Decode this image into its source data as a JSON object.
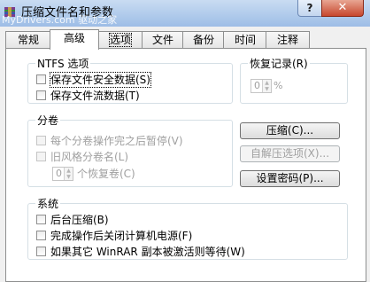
{
  "window": {
    "title": "压缩文件名和参数",
    "watermark": "MyDrivers.com 驱动之家",
    "help_label": "?",
    "close_label": "✕"
  },
  "tabs": [
    "常规",
    "高级",
    "选项",
    "文件",
    "备份",
    "时间",
    "注释"
  ],
  "ntfs": {
    "legend": "NTFS 选项",
    "items": [
      {
        "label": "保存文件安全数据(S)",
        "checked": false
      },
      {
        "label": "保存文件流数据(T)",
        "checked": false
      }
    ]
  },
  "recovery": {
    "legend": "恢复记录(R)",
    "value": "0",
    "unit": "%"
  },
  "volumes": {
    "legend": "分卷",
    "items": [
      {
        "label": "每个分卷操作完之后暂停(V)",
        "checked": false
      },
      {
        "label": "旧风格分卷名(L)",
        "checked": false
      }
    ],
    "recovery_volumes_value": "0",
    "recovery_volumes_label": "个恢复卷(C)"
  },
  "buttons": {
    "compression": "压缩(C)...",
    "sfx_options": "自解压选项(X)...",
    "set_password": "设置密码(P)..."
  },
  "system": {
    "legend": "系统",
    "items": [
      {
        "label": "后台压缩(B)",
        "checked": false
      },
      {
        "label": "完成操作后关闭计算机电源(F)",
        "checked": false
      },
      {
        "label": "如果其它 WinRAR 副本被激活则等待(W)",
        "checked": false
      }
    ]
  }
}
